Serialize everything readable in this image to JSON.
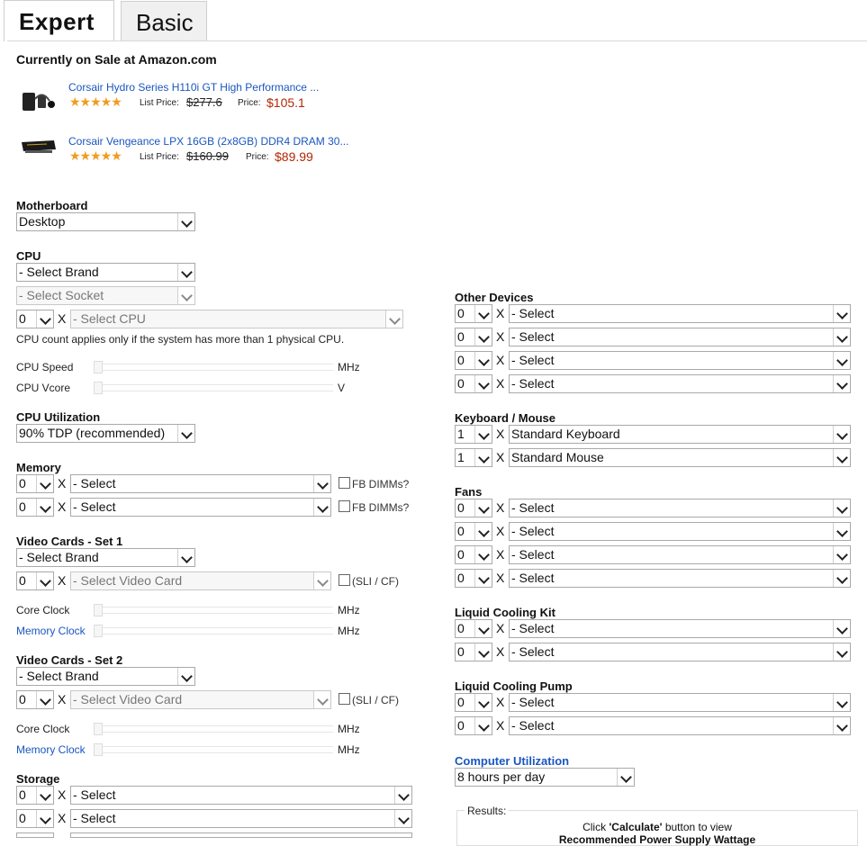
{
  "tabs": {
    "expert": "Expert",
    "basic": "Basic"
  },
  "sale": {
    "heading": "Currently on Sale at Amazon.com",
    "products": [
      {
        "name": "Corsair Hydro Series H110i GT High Performance ...",
        "stars": "★★★★★",
        "list_label": "List Price:",
        "list_price": "$277.6",
        "price_label": "Price:",
        "price": "$105.1",
        "icon": "liquid-cooler-image"
      },
      {
        "name": "Corsair Vengeance LPX 16GB (2x8GB) DDR4 DRAM 30...",
        "stars": "★★★★★",
        "list_label": "List Price:",
        "list_price": "$160.99",
        "price_label": "Price:",
        "price": "$89.99",
        "icon": "ram-stick-image"
      }
    ]
  },
  "motherboard": {
    "label": "Motherboard",
    "value": "Desktop"
  },
  "cpu": {
    "label": "CPU",
    "brand": "- Select Brand",
    "socket": "- Select Socket",
    "count": "0",
    "x": "X",
    "cpu": "- Select CPU",
    "note": "CPU count applies only if the system has more than 1 physical CPU.",
    "speed_label": "CPU Speed",
    "speed_unit": "MHz",
    "vcore_label": "CPU Vcore",
    "vcore_unit": "V"
  },
  "cpu_util": {
    "label": "CPU Utilization",
    "value": "90% TDP (recommended)"
  },
  "memory": {
    "label": "Memory",
    "rows": [
      {
        "count": "0",
        "x": "X",
        "value": "- Select",
        "cb": "FB DIMMs?"
      },
      {
        "count": "0",
        "x": "X",
        "value": "- Select",
        "cb": "FB DIMMs?"
      }
    ]
  },
  "video1": {
    "label": "Video Cards - Set 1",
    "brand": "- Select Brand",
    "count": "0",
    "x": "X",
    "card": "- Select Video Card",
    "cb": "(SLI / CF)",
    "core_label": "Core Clock",
    "core_unit": "MHz",
    "mem_label": "Memory Clock",
    "mem_unit": "MHz"
  },
  "video2": {
    "label": "Video Cards - Set 2",
    "brand": "- Select Brand",
    "count": "0",
    "x": "X",
    "card": "- Select Video Card",
    "cb": "(SLI / CF)",
    "core_label": "Core Clock",
    "core_unit": "MHz",
    "mem_label": "Memory Clock",
    "mem_unit": "MHz"
  },
  "storage": {
    "label": "Storage",
    "rows": [
      {
        "count": "0",
        "x": "X",
        "value": "- Select"
      },
      {
        "count": "0",
        "x": "X",
        "value": "- Select"
      }
    ]
  },
  "other": {
    "label": "Other Devices",
    "rows": [
      {
        "count": "0",
        "x": "X",
        "value": "- Select"
      },
      {
        "count": "0",
        "x": "X",
        "value": "- Select"
      },
      {
        "count": "0",
        "x": "X",
        "value": "- Select"
      },
      {
        "count": "0",
        "x": "X",
        "value": "- Select"
      }
    ]
  },
  "kbm": {
    "label": "Keyboard / Mouse",
    "rows": [
      {
        "count": "1",
        "x": "X",
        "value": "Standard Keyboard"
      },
      {
        "count": "1",
        "x": "X",
        "value": "Standard Mouse"
      }
    ]
  },
  "fans": {
    "label": "Fans",
    "rows": [
      {
        "count": "0",
        "x": "X",
        "value": "- Select"
      },
      {
        "count": "0",
        "x": "X",
        "value": "- Select"
      },
      {
        "count": "0",
        "x": "X",
        "value": "- Select"
      },
      {
        "count": "0",
        "x": "X",
        "value": "- Select"
      }
    ]
  },
  "lck": {
    "label": "Liquid Cooling Kit",
    "rows": [
      {
        "count": "0",
        "x": "X",
        "value": "- Select"
      },
      {
        "count": "0",
        "x": "X",
        "value": "- Select"
      }
    ]
  },
  "lcp": {
    "label": "Liquid Cooling Pump",
    "rows": [
      {
        "count": "0",
        "x": "X",
        "value": "- Select"
      },
      {
        "count": "0",
        "x": "X",
        "value": "- Select"
      }
    ]
  },
  "comp_util": {
    "label": "Computer Utilization",
    "value": "8 hours per day"
  },
  "results": {
    "legend": "Results:",
    "line1_pre": "Click ",
    "line1_btn": "'Calculate'",
    "line1_post": " button to view",
    "line2": "Recommended Power Supply Wattage"
  },
  "colors": {
    "link": "#1a56c0",
    "sale_price": "#b12704",
    "stars": "#f09c1f"
  }
}
